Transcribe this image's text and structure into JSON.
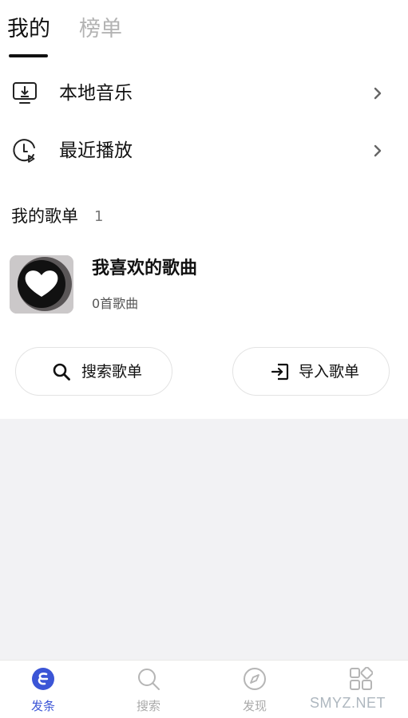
{
  "tabs": {
    "mine": "我的",
    "charts": "榜单"
  },
  "menu": {
    "local_music": "本地音乐",
    "recent_play": "最近播放"
  },
  "playlists": {
    "title": "我的歌单",
    "count": "1",
    "items": [
      {
        "name": "我喜欢的歌曲",
        "subtitle": "0首歌曲"
      }
    ]
  },
  "actions": {
    "search_playlist": "搜索歌单",
    "import_playlist": "导入歌单"
  },
  "bottom_nav": [
    {
      "label": "发条",
      "active": true
    },
    {
      "label": "搜索",
      "active": false
    },
    {
      "label": "发现",
      "active": false
    },
    {
      "label": "",
      "active": false
    }
  ],
  "watermark": "SMYZ.NET",
  "colors": {
    "accent": "#3b55d6",
    "inactive": "#aaaaaa",
    "background_gray": "#f2f2f4"
  }
}
